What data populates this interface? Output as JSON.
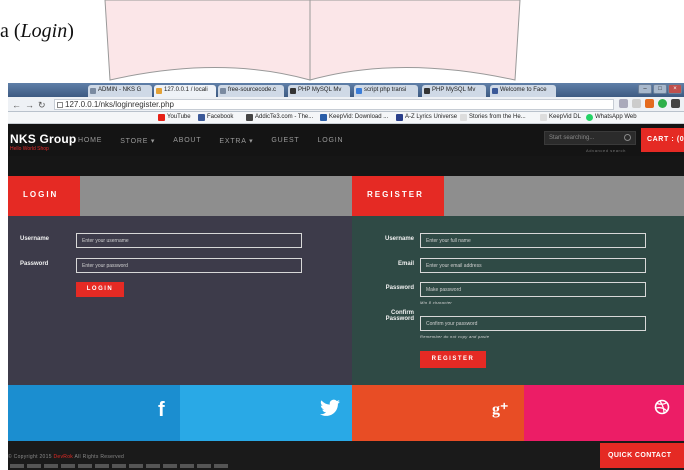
{
  "document": {
    "caption_prefix": "a (",
    "caption_italic": "Login",
    "caption_suffix": ")"
  },
  "browser": {
    "tabs": [
      {
        "label": "ADMIN - NKS G"
      },
      {
        "label": "127.0.0.1 / locali"
      },
      {
        "label": "free-sourcecode.c"
      },
      {
        "label": "PHP MySQL Mv"
      },
      {
        "label": "script php transi"
      },
      {
        "label": "PHP MySQL Mv"
      },
      {
        "label": "Welcome to Face"
      }
    ],
    "url": "127.0.0.1/nks/loginregister.php",
    "bookmarks": [
      {
        "label": "YouTube"
      },
      {
        "label": "Facebook"
      },
      {
        "label": "AddicTe3.com - The..."
      },
      {
        "label": "KeepVid: Download ..."
      },
      {
        "label": "A-Z Lyrics Universe"
      },
      {
        "label": "Stories from the He..."
      },
      {
        "label": "KeepVid DL"
      },
      {
        "label": "WhatsApp Web"
      }
    ],
    "colors": {
      "facebook": "#3b5998",
      "youtube": "#e62117",
      "whatsapp": "#25d366"
    }
  },
  "site": {
    "logo": "NKS Group",
    "logo_sub": "Hello World Shop",
    "menu": [
      "HOME",
      "STORE ▾",
      "ABOUT",
      "EXTRA ▾",
      "GUEST",
      "LOGIN"
    ],
    "search_placeholder": "Start searching...",
    "advanced_search": "Advanced search",
    "cart_label": "CART : (0",
    "accent": "#e52a24"
  },
  "login": {
    "title": "LOGIN",
    "username_label": "Username",
    "username_placeholder": "Enter your username",
    "password_label": "Password",
    "password_placeholder": "Enter your password",
    "button": "LOGIN"
  },
  "register": {
    "title": "REGISTER",
    "username_label": "Username",
    "username_placeholder": "Enter your full name",
    "email_label": "Email",
    "email_placeholder": "Enter your email address",
    "password_label": "Password",
    "password_placeholder": "Make password",
    "password_hint": "Min 8 character",
    "confirm_label_1": "Confirm",
    "confirm_label_2": "Password",
    "confirm_placeholder": "Confirm your password",
    "confirm_hint": "Remember do not copy and paste",
    "button": "REGISTER"
  },
  "social": {
    "facebook_glyph": "f",
    "gplus_glyph": "g⁺"
  },
  "footer": {
    "copyright_prefix": "© Copyright 2015",
    "copyright_brand": "DevRok",
    "copyright_suffix": "All Rights Reserved",
    "quick_contact": "QUICK CONTACT"
  }
}
